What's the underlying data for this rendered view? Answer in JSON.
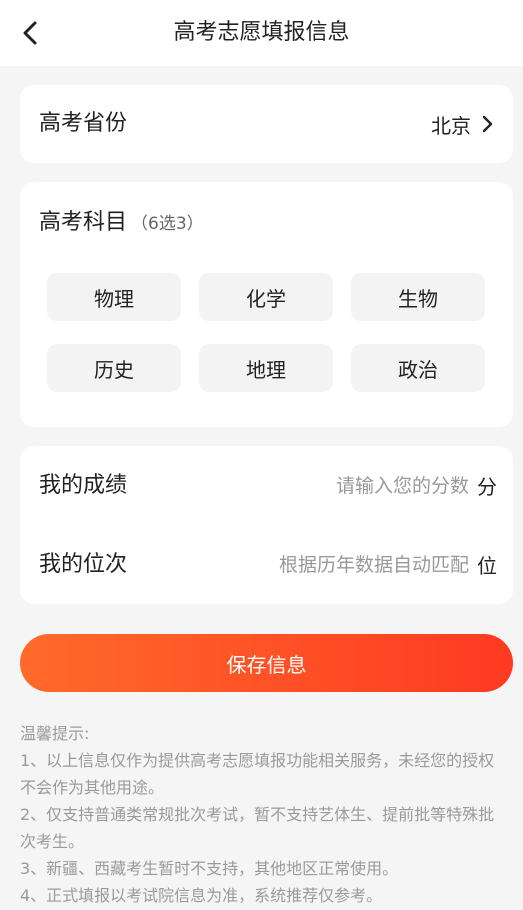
{
  "header": {
    "title": "高考志愿填报信息"
  },
  "province": {
    "label": "高考省份",
    "value": "北京"
  },
  "subjects": {
    "label": "高考科目",
    "hint": "（6选3）",
    "items": [
      "物理",
      "化学",
      "生物",
      "历史",
      "地理",
      "政治"
    ]
  },
  "scores": {
    "score_label": "我的成绩",
    "score_placeholder": "请输入您的分数",
    "score_unit": "分",
    "rank_label": "我的位次",
    "rank_placeholder": "根据历年数据自动匹配",
    "rank_unit": "位"
  },
  "save_button": "保存信息",
  "tips": {
    "title": "温馨提示:",
    "items": [
      "1、以上信息仅作为提供高考志愿填报功能相关服务，未经您的授权不会作为其他用途。",
      "2、仅支持普通类常规批次考试，暂不支持艺体生、提前批等特殊批次考生。",
      "3、新疆、西藏考生暂时不支持，其他地区正常使用。",
      "4、正式填报以考试院信息为准，系统推荐仅参考。"
    ]
  },
  "colors": {
    "accent_start": "#ff6a2a",
    "accent_end": "#ff3a22"
  },
  "icons": {
    "back": "chevron-left-icon",
    "province_arrow": "chevron-right-icon"
  }
}
